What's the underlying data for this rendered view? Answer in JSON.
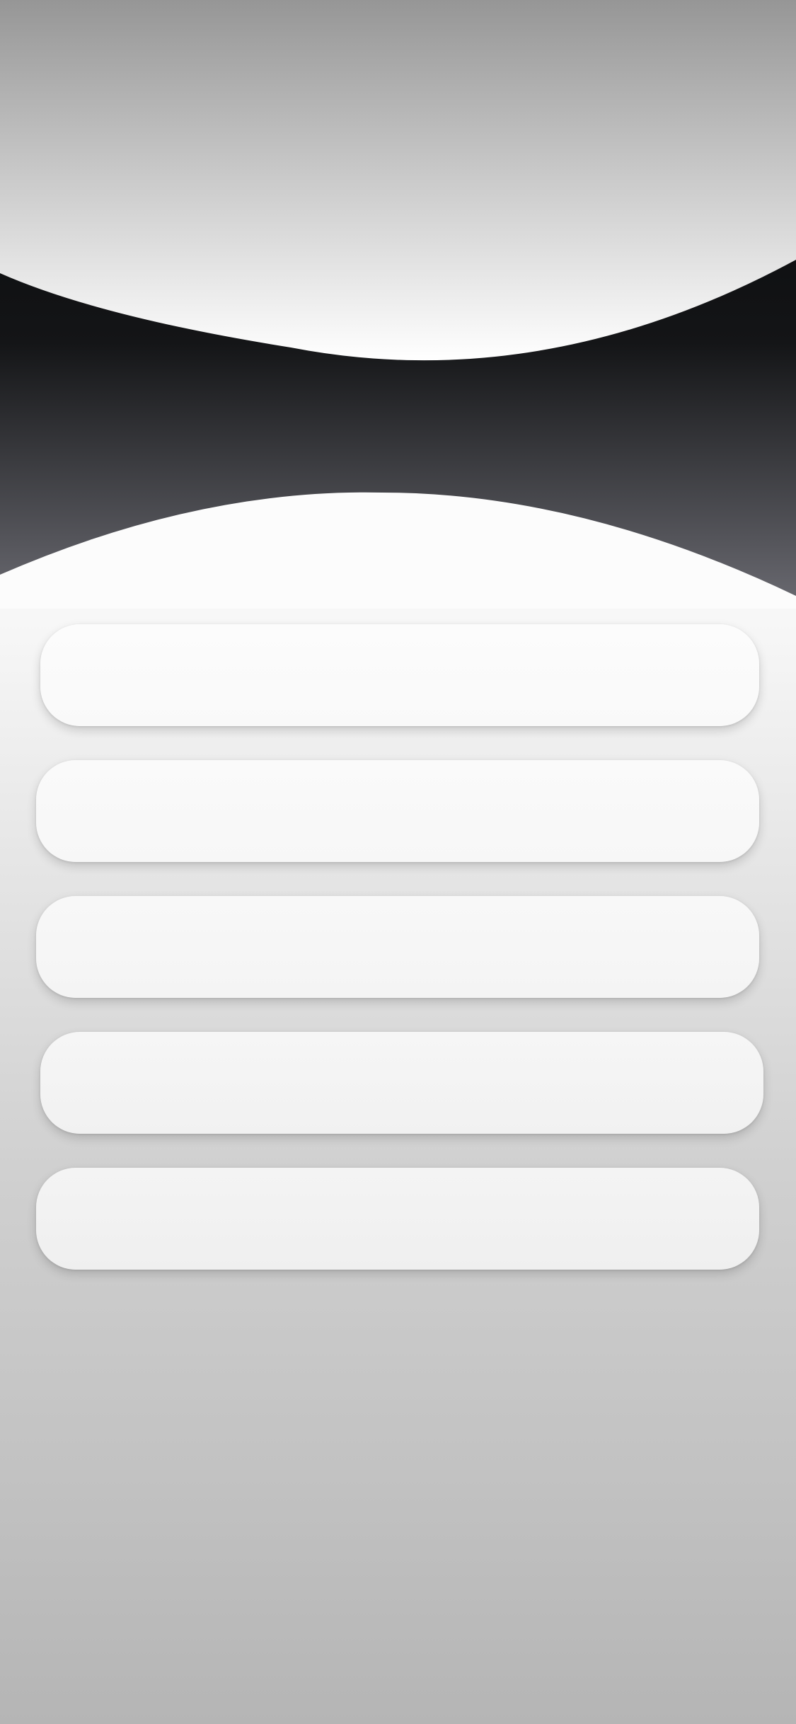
{
  "colors": {
    "top_band_start": "#969696",
    "top_band_end": "#ffffff",
    "dark_band_start": "#101113",
    "dark_band_end": "#6a6a70",
    "page_background_start": "#ffffff",
    "page_background_end": "#b5b5b5",
    "button_fill": "#f7f7f7"
  },
  "menu": {
    "buttons": [
      {
        "label": ""
      },
      {
        "label": ""
      },
      {
        "label": ""
      },
      {
        "label": ""
      },
      {
        "label": ""
      }
    ]
  }
}
